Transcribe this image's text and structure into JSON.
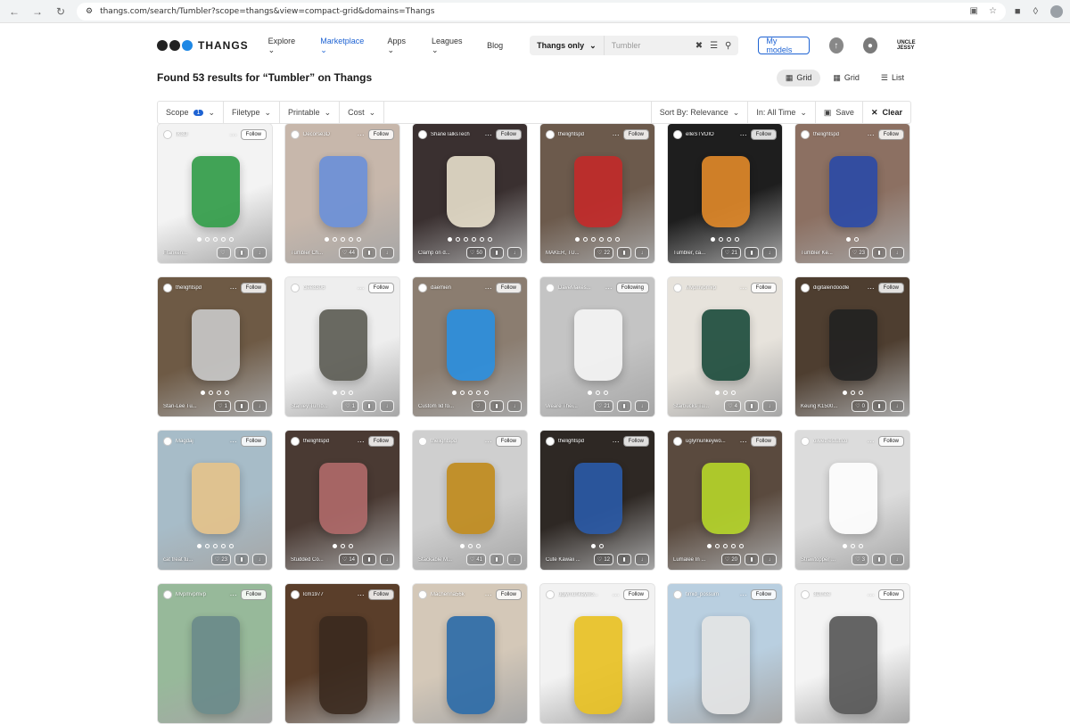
{
  "browser": {
    "url": "thangs.com/search/Tumbler?scope=thangs&view=compact-grid&domains=Thangs"
  },
  "nav": {
    "logo": "THANGS",
    "links": [
      "Explore",
      "Marketplace",
      "Apps",
      "Leagues",
      "Blog"
    ],
    "active_link": "Marketplace",
    "search_scope": "Thangs only",
    "search_query": "Tumbler",
    "my_models": "My models",
    "brand": "UNCLE JESSY"
  },
  "results": {
    "title": "Found 53 results for “Tumbler” on Thangs",
    "views": [
      "Grid",
      "Grid",
      "List"
    ]
  },
  "filters": {
    "scope": "Scope",
    "scope_count": "1",
    "filetype": "Filetype",
    "printable": "Printable",
    "cost": "Cost",
    "sort": "Sort By: Relevance",
    "time": "In: All Time",
    "save": "Save",
    "clear": "Clear"
  },
  "cards": [
    {
      "user": "IK3D",
      "follow": "Follow",
      "title": "Franken...",
      "likes": "",
      "bg": "#f3f3f3",
      "accent": "#2e9b45",
      "dots": 5
    },
    {
      "user": "Decorse3D",
      "follow": "Follow",
      "title": "Tumbler Ch...",
      "likes": "44",
      "bg": "#c7b7ab",
      "accent": "#6a8fd9",
      "dots": 5
    },
    {
      "user": "ShaneTalksTech",
      "follow": "Follow",
      "title": "Clamp on d...",
      "likes": "50",
      "bg": "#3a3030",
      "accent": "#e8e0cc",
      "dots": 6
    },
    {
      "user": "thelightspd",
      "follow": "Follow",
      "title": "MAKER, TU...",
      "likes": "22",
      "bg": "#6c5a4c",
      "accent": "#c42a2a",
      "dots": 6
    },
    {
      "user": "elleSTVDIO",
      "follow": "Follow",
      "title": "Tumbler, ca...",
      "likes": "21",
      "bg": "#1e1e1e",
      "accent": "#e38a2a",
      "dots": 4
    },
    {
      "user": "thelightspd",
      "follow": "Follow",
      "title": "Tumbler Ke...",
      "likes": "23",
      "bg": "#8c7062",
      "accent": "#2a4aa8",
      "dots": 2
    },
    {
      "user": "thelightspd",
      "follow": "Follow",
      "title": "Stan-Lee Tu...",
      "likes": "1",
      "bg": "#6e5a45",
      "accent": "#c9c9c9",
      "dots": 4
    },
    {
      "user": "clee8306",
      "follow": "Follow",
      "title": "Stanley Tumb...",
      "likes": "1",
      "bg": "#eeeeee",
      "accent": "#5a5a52",
      "dots": 3
    },
    {
      "user": "daemien",
      "follow": "Follow",
      "title": "Custom lid fo...",
      "likes": "",
      "bg": "#8b7d70",
      "accent": "#2a8fe0",
      "dots": 5
    },
    {
      "user": "DaveMakes...",
      "follow": "Following",
      "title": "Weare Thei...",
      "likes": "21",
      "bg": "#c4c4c4",
      "accent": "#f5f5f5",
      "dots": 3
    },
    {
      "user": "Mvpmvpmvp",
      "follow": "Follow",
      "title": "Starbucks Tu...",
      "likes": "4",
      "bg": "#e7e3dc",
      "accent": "#1a4a3a",
      "dots": 3
    },
    {
      "user": "digitalendoodle",
      "follow": "Follow",
      "title": "Keurig K1500...",
      "likes": "0",
      "bg": "#4e3e30",
      "accent": "#222222",
      "dots": 3
    },
    {
      "user": "Magdaj",
      "follow": "Follow",
      "title": "cat treat tu...",
      "likes": "23",
      "bg": "#a7bcc8",
      "accent": "#e6c38a",
      "dots": 5
    },
    {
      "user": "thelightspd",
      "follow": "Follow",
      "title": "Studded Co...",
      "likes": "14",
      "bg": "#4a3a33",
      "accent": "#b06a6a",
      "dots": 3
    },
    {
      "user": "thelightspd",
      "follow": "Follow",
      "title": "Stackable M...",
      "likes": "41",
      "bg": "#cfcfcf",
      "accent": "#c08a1a",
      "dots": 3
    },
    {
      "user": "thelightspd",
      "follow": "Follow",
      "title": "Cute Kawaii ...",
      "likes": "12",
      "bg": "#2e2824",
      "accent": "#2a5aa8",
      "dots": 2
    },
    {
      "user": "uglymunkeywo...",
      "follow": "Follow",
      "title": "Lumalee In ...",
      "likes": "20",
      "bg": "#5a4a3e",
      "accent": "#b6d62a",
      "dots": 5
    },
    {
      "user": "olivethestuffco",
      "follow": "Follow",
      "title": "Strawtopper ...",
      "likes": "3",
      "bg": "#dcdcdc",
      "accent": "#ffffff",
      "dots": 3
    },
    {
      "user": "Mvpmvpmvp",
      "follow": "Follow",
      "title": "",
      "likes": "",
      "bg": "#97b99a",
      "accent": "#6a8a8a",
      "dots": 0
    },
    {
      "user": "lcm1977",
      "follow": "Follow",
      "title": "",
      "likes": "",
      "bg": "#5a3e2a",
      "accent": "#3a2a1e",
      "dots": 0
    },
    {
      "user": "Machenna56k",
      "follow": "Follow",
      "title": "",
      "likes": "",
      "bg": "#d4c8b8",
      "accent": "#2a6aa8",
      "dots": 0
    },
    {
      "user": "uglymunkeywo...",
      "follow": "Follow",
      "title": "",
      "likes": "",
      "bg": "#f2f2f2",
      "accent": "#e8c020",
      "dots": 0
    },
    {
      "user": "timid_possum",
      "follow": "Follow",
      "title": "",
      "likes": "",
      "bg": "#b9cfe0",
      "accent": "#e5e5e5",
      "dots": 0
    },
    {
      "user": "3Dthee",
      "follow": "Follow",
      "title": "",
      "likes": "",
      "bg": "#f4f4f4",
      "accent": "#555555",
      "dots": 0
    }
  ]
}
